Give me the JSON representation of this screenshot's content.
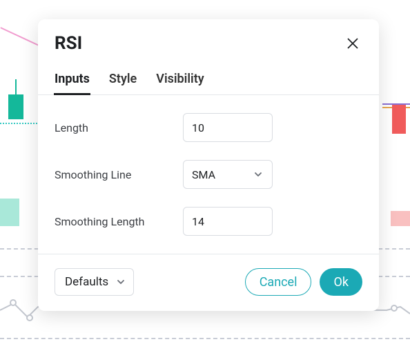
{
  "dialog": {
    "title": "RSI"
  },
  "tabs": {
    "inputs": "Inputs",
    "style": "Style",
    "visibility": "Visibility"
  },
  "fields": {
    "length": {
      "label": "Length",
      "value": "10"
    },
    "smoothing_line": {
      "label": "Smoothing Line",
      "value": "SMA"
    },
    "smoothing_length": {
      "label": "Smoothing Length",
      "value": "14"
    }
  },
  "footer": {
    "defaults": "Defaults",
    "cancel": "Cancel",
    "ok": "Ok"
  }
}
